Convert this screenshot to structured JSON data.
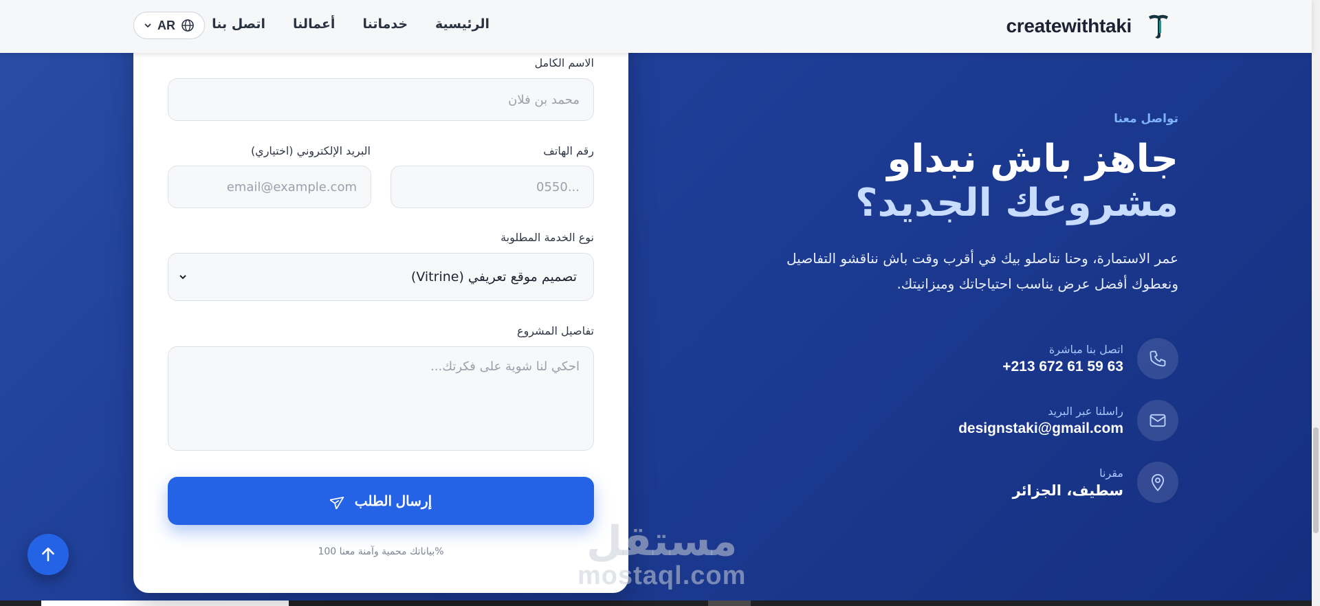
{
  "brand": {
    "name": "createwithtaki",
    "logo_letter": "T"
  },
  "nav": {
    "items": [
      "الرئيسية",
      "خدماتنا",
      "أعمالنا",
      "اتصل بنا"
    ],
    "lang": "AR"
  },
  "form": {
    "full_name_label": "الاسم الكامل",
    "full_name_placeholder": "محمد بن فلان",
    "phone_label": "رقم الهاتف",
    "phone_placeholder": "0550...",
    "email_label": "البريد الإلكتروني (اختياري)",
    "email_placeholder": "email@example.com",
    "service_label": "نوع الخدمة المطلوبة",
    "service_value": "تصميم موقع تعريفي (Vitrine)",
    "details_label": "تفاصيل المشروع",
    "details_placeholder": "احكي لنا شوية على فكرتك...",
    "submit_label": "إرسال الطلب",
    "privacy_note": "بياناتك محمية وآمنة معنا 100%"
  },
  "hero": {
    "kicker": "تواصل معنا",
    "title_line1": "جاهز باش نبداو",
    "title_line2": "مشروعك الجديد؟",
    "lead": "عمر الاستمارة، وحنا نتاصلو بيك في أقرب وقت باش نناقشو التفاصيل ونعطوك أفضل عرض يناسب احتياجاتك وميزانيتك."
  },
  "contacts": [
    {
      "caption": "اتصل بنا مباشرة",
      "value": "+213 672 61 59 63",
      "icon": "phone-icon"
    },
    {
      "caption": "راسلنا عبر البريد",
      "value": "designstaki@gmail.com",
      "icon": "mail-icon"
    },
    {
      "caption": "مقرنا",
      "value": "سطيف، الجزائر",
      "icon": "map-pin-icon"
    }
  ],
  "watermark": {
    "ar": "مستقل",
    "en": "mostaql.com"
  },
  "colors": {
    "primary": "#2563e6",
    "hero_bg": "#1f3f99",
    "kicker": "#7fb1ff",
    "accent_title": "#c7dcff"
  }
}
